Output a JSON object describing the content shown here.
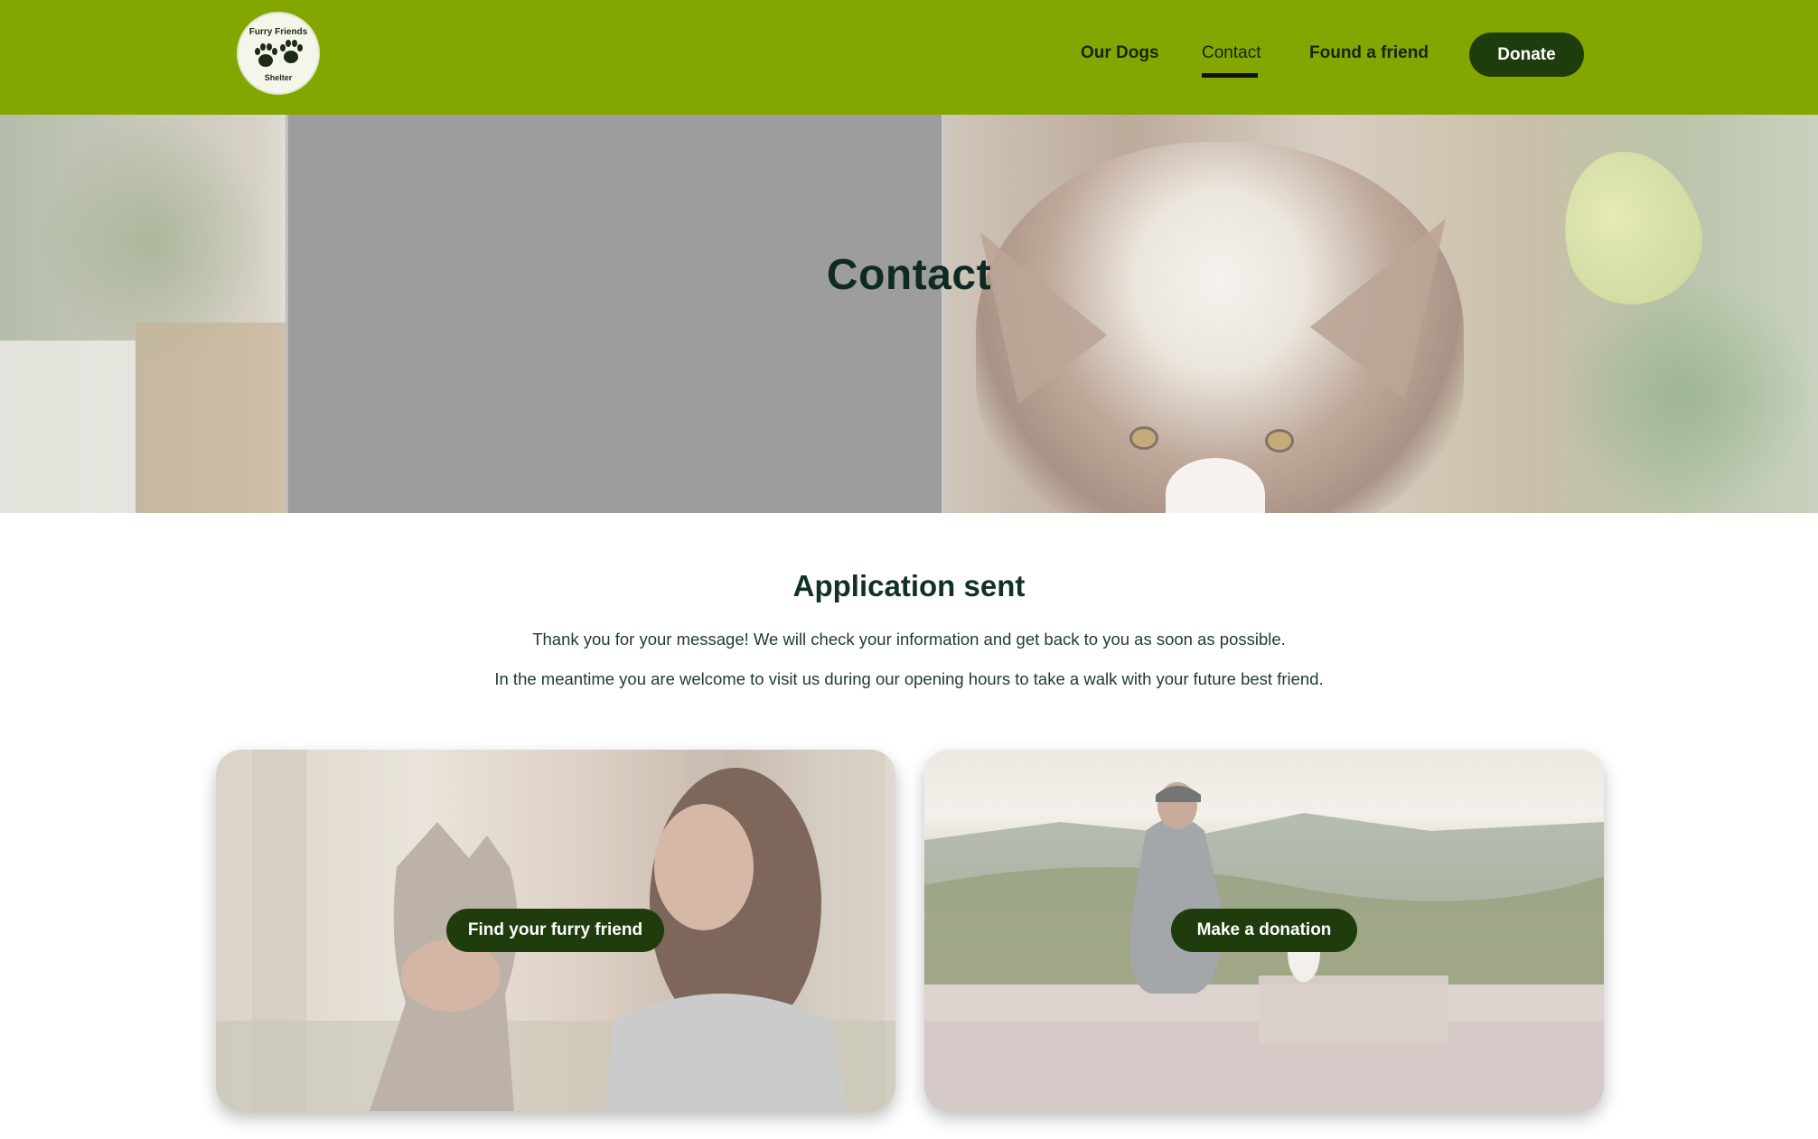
{
  "header": {
    "logo": {
      "top_text": "Furry Friends",
      "bottom_text": "Shelter",
      "icon": "paw-prints-icon"
    },
    "nav": [
      {
        "label": "Our Dogs",
        "active": false
      },
      {
        "label": "Contact",
        "active": true
      },
      {
        "label": "Found a friend",
        "active": false
      }
    ],
    "donate_label": "Donate"
  },
  "hero": {
    "title": "Contact"
  },
  "main": {
    "title": "Application sent",
    "paragraph_1": "Thank you for your message! We will check your information and get back to you as soon as possible.",
    "paragraph_2": "In the meantime you are welcome to visit us during our opening hours to take a walk with your future best friend."
  },
  "cards": [
    {
      "button_label": "Find your furry friend"
    },
    {
      "button_label": "Make a donation"
    }
  ],
  "colors": {
    "header_bg": "#84a600",
    "button_bg": "#1f3d0c",
    "text": "#12302a"
  }
}
